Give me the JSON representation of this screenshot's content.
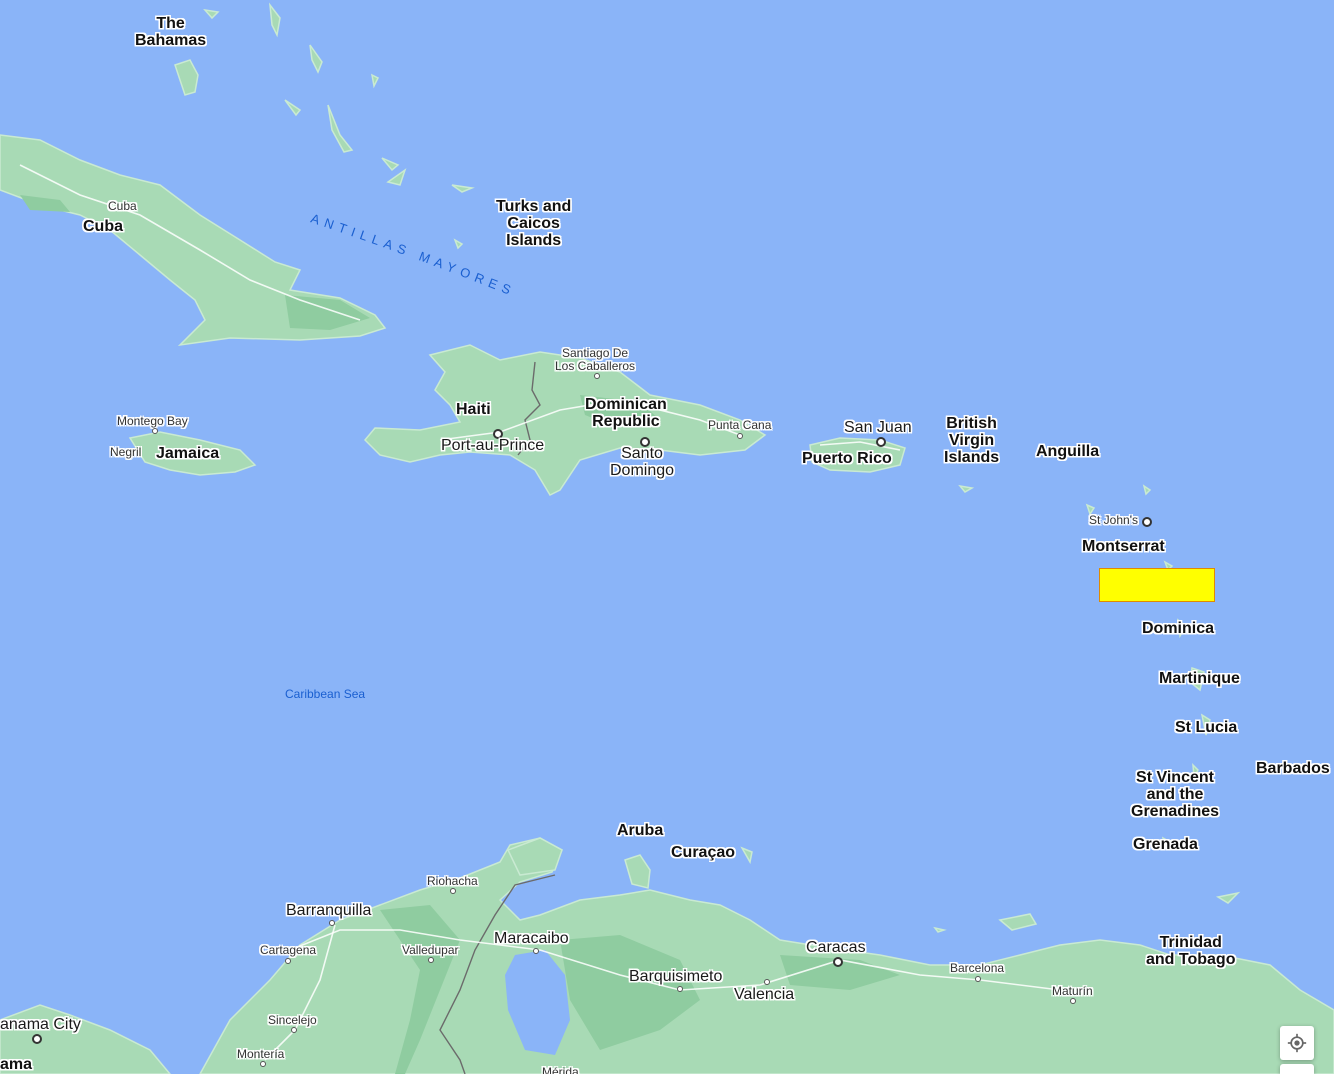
{
  "map": {
    "countries": {
      "bahamas": "The\nBahamas",
      "cuba": "Cuba",
      "turks": "Turks and\nCaicos\nIslands",
      "jamaica": "Jamaica",
      "haiti": "Haiti",
      "dominican": "Dominican\nRepublic",
      "puerto_rico": "Puerto Rico",
      "bvi": "British\nVirgin\nIslands",
      "anguilla": "Anguilla",
      "montserrat": "Montserrat",
      "dominica": "Dominica",
      "martinique": "Martinique",
      "st_lucia": "St Lucia",
      "barbados": "Barbados",
      "st_vincent": "St Vincent\nand the\nGrenadines",
      "grenada": "Grenada",
      "aruba": "Aruba",
      "curacao": "Curaçao",
      "trinidad": "Trinidad\nand Tobago"
    },
    "cities": {
      "cuba_city": "Cuba",
      "santiago": "Santiago De\nLos Caballeros",
      "montego": "Montego Bay",
      "negril": "Negril",
      "port_au_prince": "Port-au-Prince",
      "santo_domingo": "Santo\nDomingo",
      "punta_cana": "Punta Cana",
      "san_juan": "San Juan",
      "st_johns": "St John's",
      "riohacha": "Riohacha",
      "barranquilla": "Barranquilla",
      "cartagena": "Cartagena",
      "valledupar": "Valledupar",
      "maracaibo": "Maracaibo",
      "barquisimeto": "Barquisimeto",
      "valencia": "Valencia",
      "caracas": "Caracas",
      "barcelona": "Barcelona",
      "maturin": "Maturín",
      "sincelejo": "Sincelejo",
      "monteria": "Montería",
      "panama_city": "anama City",
      "panama": "ama",
      "merida": "Mérida"
    },
    "water": {
      "caribbean": "Caribbean Sea",
      "antillas": "ANTILLAS MAYORES"
    },
    "colors": {
      "water": "#8ab4f8",
      "land": "#a8dab5",
      "highlight": "#ffff00"
    },
    "controls": {
      "locate_icon": "my-location-icon"
    }
  }
}
